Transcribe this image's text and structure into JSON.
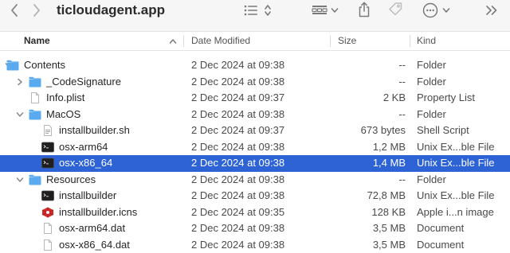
{
  "window": {
    "title": "ticloudagent.app"
  },
  "toolbar": {
    "icons": [
      "back-icon",
      "forward-icon",
      "list-view-icon",
      "sort-icon",
      "group-icon",
      "share-icon",
      "tag-icon",
      "more-icon",
      "overflow-icon"
    ]
  },
  "columns": {
    "name": "Name",
    "date": "Date Modified",
    "size": "Size",
    "kind": "Kind"
  },
  "colors": {
    "selection": "#2e63d6",
    "folder": "#5aaaf0",
    "gem": "#d52b2b"
  },
  "rows": [
    {
      "name": "Contents",
      "date": "2 Dec 2024 at 09:38",
      "size": "--",
      "kind": "Folder",
      "icon": "folder-icon",
      "disclosure": "expanded",
      "level": 0,
      "selected": false
    },
    {
      "name": "_CodeSignature",
      "date": "2 Dec 2024 at 09:38",
      "size": "--",
      "kind": "Folder",
      "icon": "folder-icon",
      "disclosure": "collapsed",
      "level": 1,
      "selected": false
    },
    {
      "name": "Info.plist",
      "date": "2 Dec 2024 at 09:37",
      "size": "2 KB",
      "kind": "Property List",
      "icon": "document-icon",
      "disclosure": "none",
      "level": 1,
      "selected": false
    },
    {
      "name": "MacOS",
      "date": "2 Dec 2024 at 09:38",
      "size": "--",
      "kind": "Folder",
      "icon": "folder-icon",
      "disclosure": "expanded",
      "level": 1,
      "selected": false
    },
    {
      "name": "installbuilder.sh",
      "date": "2 Dec 2024 at 09:37",
      "size": "673 bytes",
      "kind": "Shell Script",
      "icon": "script-icon",
      "disclosure": "none",
      "level": 2,
      "selected": false
    },
    {
      "name": "osx-arm64",
      "date": "2 Dec 2024 at 09:38",
      "size": "1,2 MB",
      "kind": "Unix Ex...ble File",
      "icon": "terminal-icon",
      "disclosure": "none",
      "level": 2,
      "selected": false
    },
    {
      "name": "osx-x86_64",
      "date": "2 Dec 2024 at 09:38",
      "size": "1,4 MB",
      "kind": "Unix Ex...ble File",
      "icon": "terminal-icon",
      "disclosure": "none",
      "level": 2,
      "selected": true
    },
    {
      "name": "Resources",
      "date": "2 Dec 2024 at 09:38",
      "size": "--",
      "kind": "Folder",
      "icon": "folder-icon",
      "disclosure": "expanded",
      "level": 1,
      "selected": false
    },
    {
      "name": "installbuilder",
      "date": "2 Dec 2024 at 09:38",
      "size": "72,8 MB",
      "kind": "Unix Ex...ble File",
      "icon": "terminal-icon",
      "disclosure": "none",
      "level": 2,
      "selected": false
    },
    {
      "name": "installbuilder.icns",
      "date": "2 Dec 2024 at 09:35",
      "size": "128 KB",
      "kind": "Apple i...n image",
      "icon": "icns-icon",
      "disclosure": "none",
      "level": 2,
      "selected": false
    },
    {
      "name": "osx-arm64.dat",
      "date": "2 Dec 2024 at 09:38",
      "size": "3,5 MB",
      "kind": "Document",
      "icon": "document-icon",
      "disclosure": "none",
      "level": 2,
      "selected": false
    },
    {
      "name": "osx-x86_64.dat",
      "date": "2 Dec 2024 at 09:38",
      "size": "3,5 MB",
      "kind": "Document",
      "icon": "document-icon",
      "disclosure": "none",
      "level": 2,
      "selected": false
    }
  ]
}
